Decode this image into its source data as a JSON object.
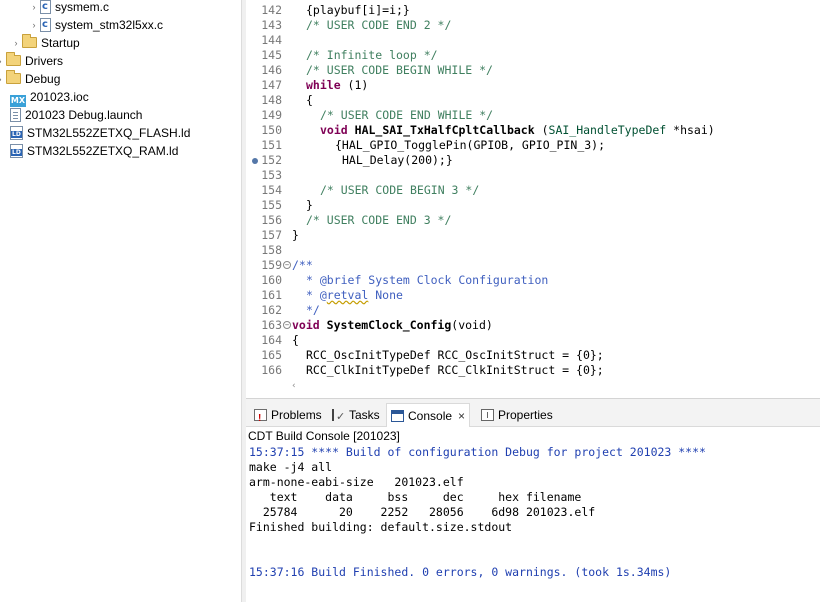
{
  "explorer": {
    "items": [
      {
        "label": "sysmem.c",
        "icon": "c-file-icon",
        "arrow": "›"
      },
      {
        "label": "system_stm32l5xx.c",
        "icon": "c-file-icon",
        "arrow": "›"
      },
      {
        "label": "Startup",
        "icon": "folder-icon",
        "arrow": "›"
      },
      {
        "label": "Drivers",
        "icon": "folder-icon",
        "arrow": "›"
      },
      {
        "label": "Debug",
        "icon": "folder-icon",
        "arrow": "›"
      },
      {
        "label": "201023.ioc",
        "icon": "mx-file-icon",
        "badge": "MX"
      },
      {
        "label": "201023 Debug.launch",
        "icon": "launch-file-icon"
      },
      {
        "label": "STM32L552ZETXQ_FLASH.ld",
        "icon": "linker-file-icon"
      },
      {
        "label": "STM32L552ZETXQ_RAM.ld",
        "icon": "linker-file-icon"
      }
    ]
  },
  "editor": {
    "line_numbers": [
      "142",
      "143",
      "144",
      "145",
      "146",
      "147",
      "148",
      "149",
      "150",
      "151",
      "152",
      "153",
      "154",
      "155",
      "156",
      "157",
      "158",
      "159",
      "160",
      "161",
      "162",
      "163",
      "164",
      "165",
      "166"
    ],
    "code": {
      "l142": "{playbuf[i]=i;}",
      "l143": "/* USER CODE END 2 */",
      "l145": "/* Infinite loop */",
      "l146": "/* USER CODE BEGIN WHILE */",
      "l147_kw": "while",
      "l147_rest": " (1)",
      "l148": "{",
      "l149": "/* USER CODE END WHILE */",
      "l150_kw": "void",
      "l150_fn": "HAL_SAI_TxHalfCpltCallback",
      "l150_p1": " (",
      "l150_type": "SAI_HandleTypeDef",
      "l150_p2": " *hsai)",
      "l151": "{HAL_GPIO_TogglePin(GPIOB, GPIO_PIN_3);",
      "l152": "HAL_Delay(200);}",
      "l154": "/* USER CODE BEGIN 3 */",
      "l155": "}",
      "l156": "/* USER CODE END 3 */",
      "l157": "}",
      "l159": "/**",
      "l160": "* @brief System Clock Configuration",
      "l161_a": "* @",
      "l161_b": "retval",
      "l161_c": " None",
      "l162": "*/",
      "l163_kw": "void",
      "l163_fn": "SystemClock_Config",
      "l163_p1": "(",
      "l163_kw2": "void",
      "l163_p2": ")",
      "l164": "{",
      "l165": "RCC_OscInitTypeDef RCC_OscInitStruct = {0};",
      "l166": "RCC_ClkInitTypeDef RCC_ClkInitStruct = {0};"
    },
    "scroll_left_arrow": "‹"
  },
  "panel": {
    "tabs": [
      {
        "label": "Problems"
      },
      {
        "label": "Tasks"
      },
      {
        "label": "Console",
        "close": "×"
      },
      {
        "label": "Properties"
      }
    ],
    "console_title": "CDT Build Console [201023]",
    "console_lines": [
      "15:37:15 **** Build of configuration Debug for project 201023 ****",
      "make -j4 all",
      "arm-none-eabi-size   201023.elf",
      "   text    data     bss     dec     hex filename",
      "  25784      20    2252   28056    6d98 201023.elf",
      "Finished building: default.size.stdout",
      "",
      "",
      "15:37:16 Build Finished. 0 errors, 0 warnings. (took 1s.34ms)"
    ]
  },
  "colors": {
    "comment": "#3f7f5f",
    "javadoc": "#3f5fbf",
    "keyword": "#7f0055",
    "type": "#005032",
    "console_info": "#1f3fb0"
  }
}
